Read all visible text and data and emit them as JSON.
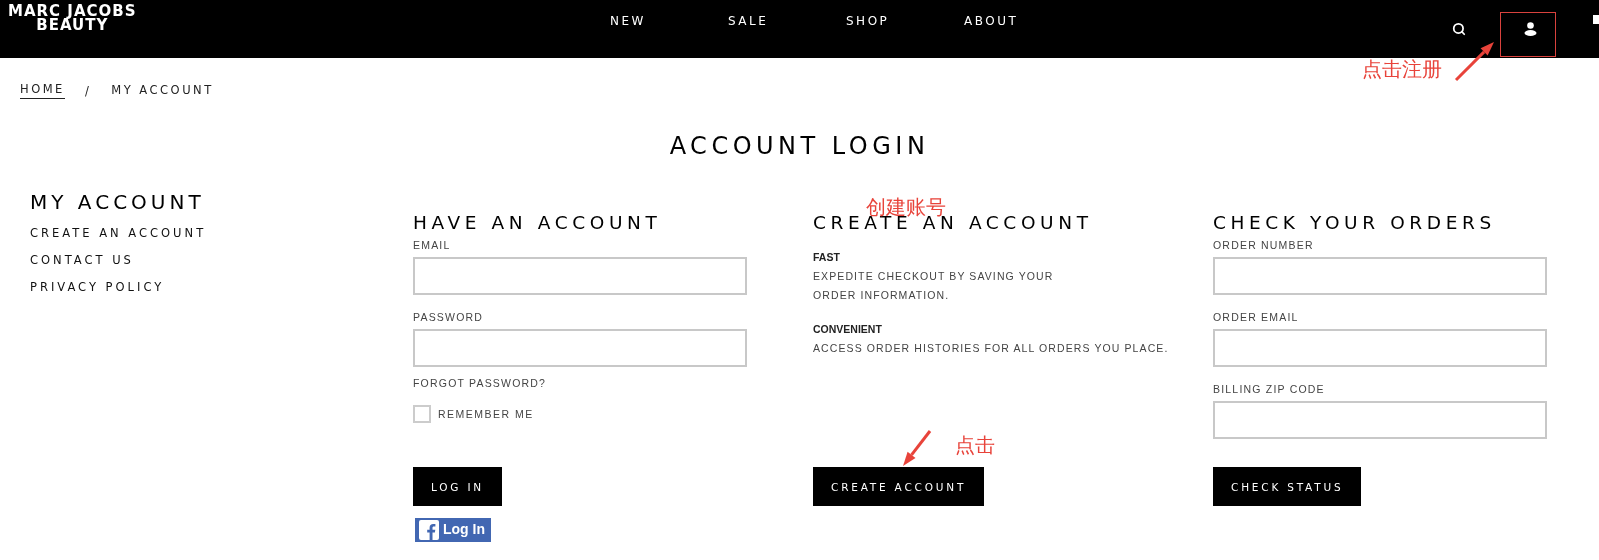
{
  "header": {
    "logo": [
      "MARC JACOBS",
      "BEAUTY"
    ],
    "nav": [
      {
        "label": "NEW"
      },
      {
        "label": "SALE"
      },
      {
        "label": "SHOP"
      },
      {
        "label": "ABOUT"
      }
    ]
  },
  "breadcrumb": {
    "separator": "/",
    "items": [
      {
        "label": "HOME",
        "current": false
      },
      {
        "label": "MY ACCOUNT",
        "current": true
      }
    ]
  },
  "page_title": "ACCOUNT LOGIN",
  "sidebar": {
    "title": "MY ACCOUNT",
    "links": [
      "CREATE AN ACCOUNT",
      "CONTACT US",
      "PRIVACY POLICY"
    ]
  },
  "login": {
    "title": "HAVE AN ACCOUNT",
    "fields": [
      {
        "label": "EMAIL"
      },
      {
        "label": "PASSWORD"
      }
    ],
    "forgot": "FORGOT PASSWORD?",
    "remember": {
      "label": "REMEMBER ME",
      "checked": false
    },
    "button": "LOG IN",
    "facebook_button": "Log In"
  },
  "create": {
    "title": "CREATE AN ACCOUNT",
    "benefits": [
      {
        "title": "FAST",
        "text": "EXPEDITE CHECKOUT BY SAVING YOUR ORDER INFORMATION."
      },
      {
        "title": "CONVENIENT",
        "text": "ACCESS ORDER HISTORIES FOR ALL ORDERS YOU PLACE."
      }
    ],
    "button": "CREATE ACCOUNT"
  },
  "orders": {
    "title": "CHECK YOUR ORDERS",
    "fields": [
      {
        "label": "ORDER NUMBER"
      },
      {
        "label": "ORDER EMAIL"
      },
      {
        "label": "BILLING ZIP CODE"
      }
    ],
    "button": "CHECK STATUS"
  },
  "annotations": [
    {
      "text": "点击注册"
    },
    {
      "text": "创建账号"
    },
    {
      "text": "点击"
    }
  ]
}
